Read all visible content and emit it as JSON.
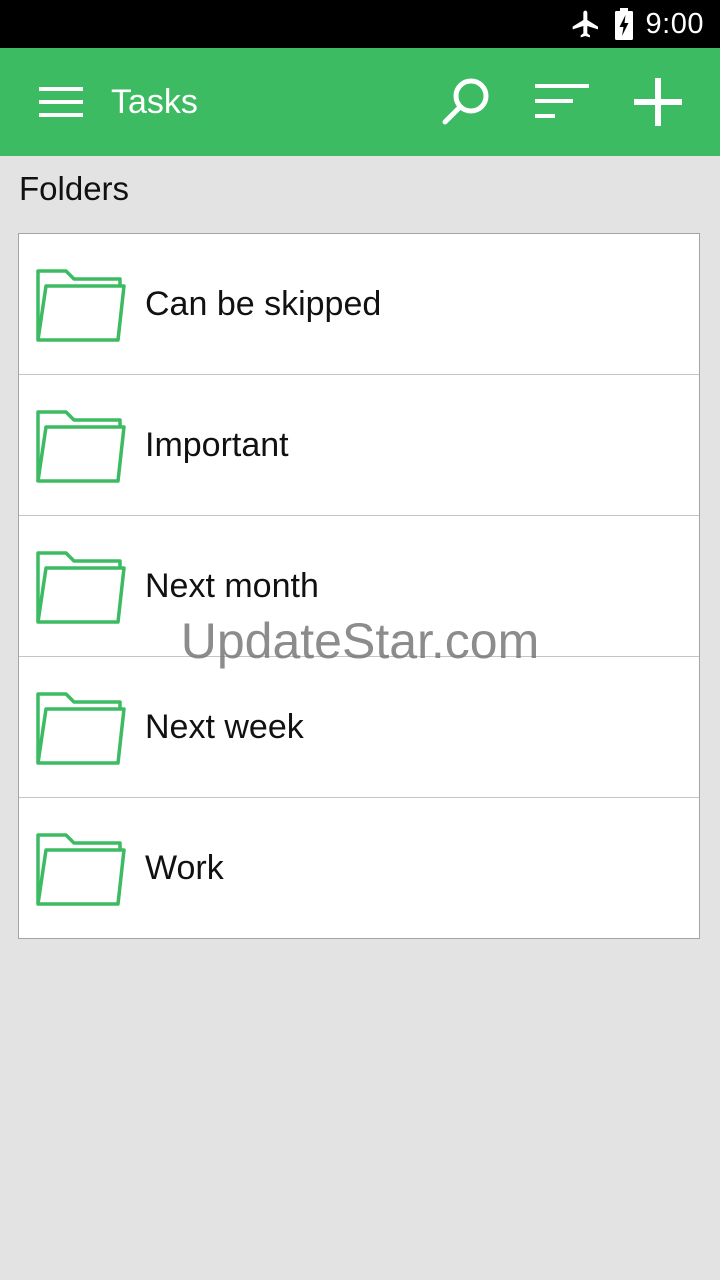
{
  "status_bar": {
    "time": "9:00",
    "icons": [
      "airplane-mode-icon",
      "battery-charging-icon"
    ]
  },
  "app_bar": {
    "title": "Tasks",
    "color": "#3cbb63",
    "icons": [
      "menu-icon",
      "search-icon",
      "sort-icon",
      "add-icon"
    ]
  },
  "section": {
    "heading": "Folders"
  },
  "folders": [
    {
      "label": "Can be skipped"
    },
    {
      "label": "Important"
    },
    {
      "label": "Next month"
    },
    {
      "label": "Next week"
    },
    {
      "label": "Work"
    }
  ],
  "folder_icon": "folder-icon",
  "watermark": "UpdateStar.com"
}
